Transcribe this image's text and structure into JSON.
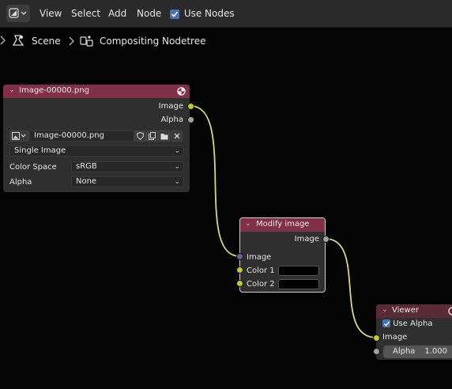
{
  "header": {
    "menus": [
      "View",
      "Select",
      "Add",
      "Node"
    ],
    "use_nodes_label": "Use Nodes",
    "use_nodes_checked": true
  },
  "breadcrumb": {
    "scene": "Scene",
    "nodetree": "Compositing Nodetree"
  },
  "image_node": {
    "title": "Image-00000.png",
    "outputs": [
      "Image",
      "Alpha"
    ],
    "image_name": "Image-00000.png",
    "source": "Single Image",
    "color_space_label": "Color Space",
    "color_space_value": "sRGB",
    "alpha_label": "Alpha",
    "alpha_value": "None"
  },
  "modify_node": {
    "title": "Modify image",
    "output": "Image",
    "input_image": "Image",
    "color1_label": "Color 1",
    "color2_label": "Color 2",
    "color1_value": "#000000",
    "color2_value": "#000000"
  },
  "viewer_node": {
    "title": "Viewer",
    "use_alpha_label": "Use Alpha",
    "use_alpha_checked": true,
    "input_image": "Image",
    "alpha_label": "Alpha",
    "alpha_value": "1.000"
  },
  "colors": {
    "node_header": "#803048",
    "link": "#c9c97a",
    "socket_color": "#c7c729",
    "socket_float": "#a1a1a1",
    "checkbox": "#4772b3"
  }
}
